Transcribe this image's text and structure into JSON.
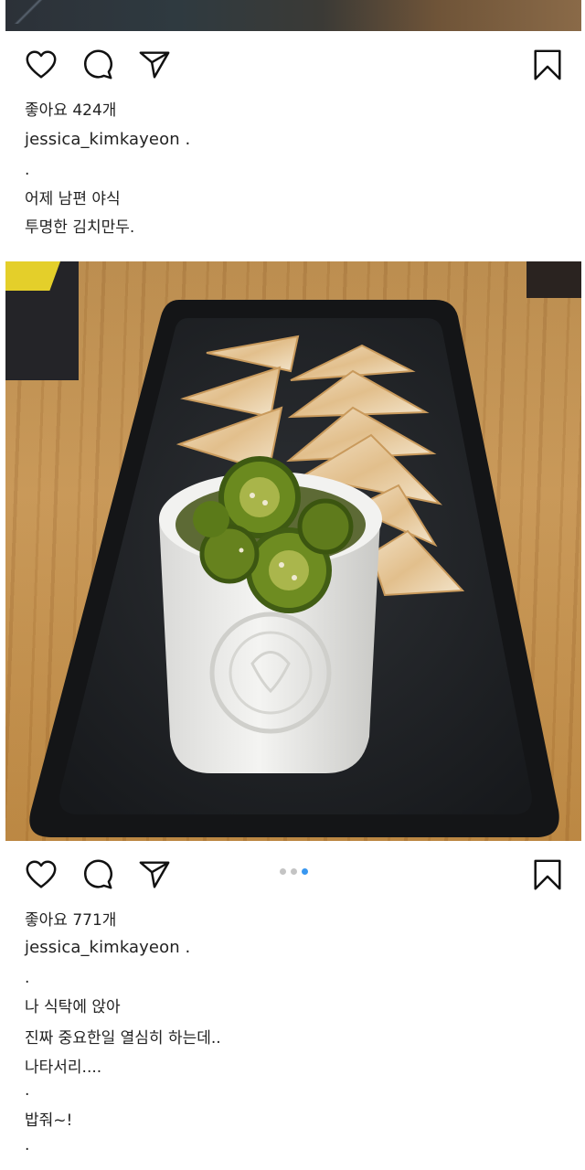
{
  "post1": {
    "likes": "좋아요 424개",
    "username": "jessica_kimkayeon .",
    "caption": [
      ".",
      "어제 남편 야식",
      "투명한 김치만두."
    ]
  },
  "post2": {
    "likes": "좋아요 771개",
    "username": "jessica_kimkayeon .",
    "caption": [
      ".",
      "나 식탁에 앉아",
      "진짜 중요한일 열심히 하는데..",
      "나타서리....",
      ".",
      "밥줘~!",
      "."
    ],
    "carousel": {
      "count": 3,
      "active": 3
    }
  },
  "icons": [
    "heart-icon",
    "comment-icon",
    "send-icon",
    "bookmark-icon"
  ],
  "colors": {
    "text": "#222222",
    "dot_active": "#3897f0",
    "dot_inactive": "#c4c4c4"
  }
}
